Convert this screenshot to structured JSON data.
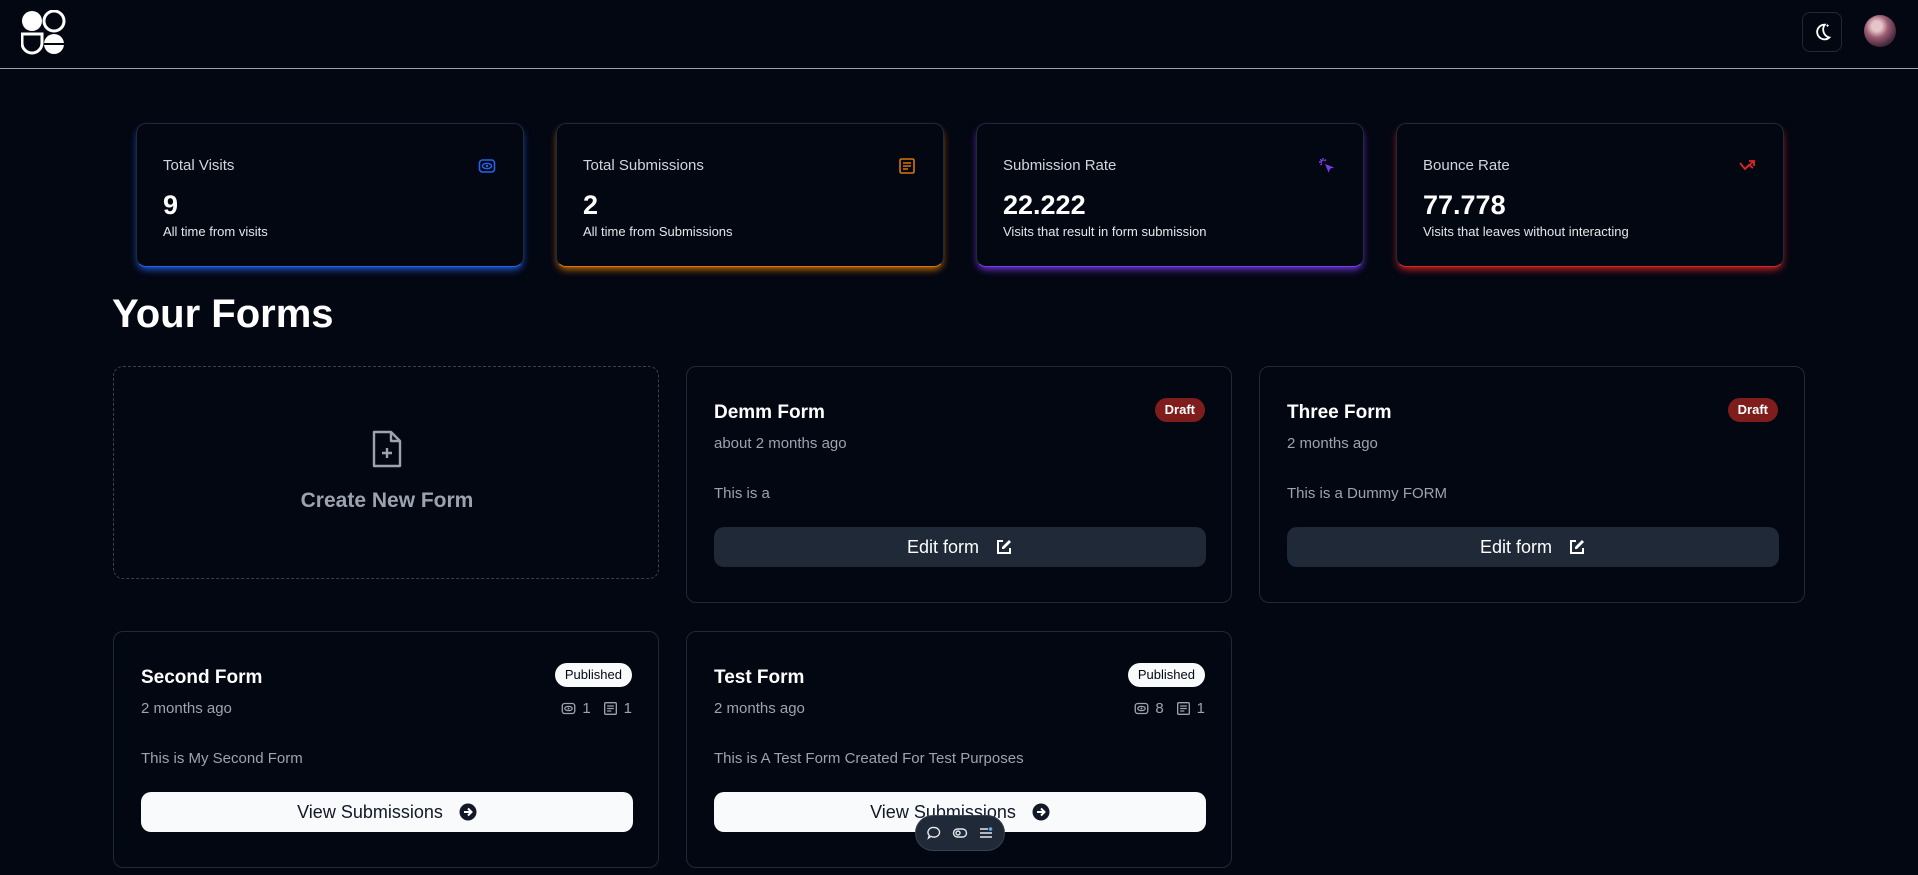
{
  "header": {
    "logo": "app-logo",
    "theme_icon": "moon-icon",
    "avatar": "user-avatar"
  },
  "stats": [
    {
      "title": "Total Visits",
      "value": "9",
      "help": "All time from visits",
      "icon": "eye-icon",
      "color": "#2563eb"
    },
    {
      "title": "Total Submissions",
      "value": "2",
      "help": "All time from Submissions",
      "icon": "submissions-icon",
      "color": "#d97706"
    },
    {
      "title": "Submission Rate",
      "value": "22.222",
      "help": "Visits that result in form submission",
      "icon": "cursor-click-icon",
      "color": "#7c3aed"
    },
    {
      "title": "Bounce Rate",
      "value": "77.778",
      "help": "Visits that leaves without interacting",
      "icon": "bounce-arrow-icon",
      "color": "#dc2626"
    }
  ],
  "section_title": "Your Forms",
  "create_label": "Create New Form",
  "forms": [
    {
      "name": "Demm Form",
      "time": "about 2 months ago",
      "desc": "This is a",
      "badge": "Draft",
      "button": "Edit form"
    },
    {
      "name": "Three Form",
      "time": "2 months ago",
      "desc": "This is a Dummy FORM",
      "badge": "Draft",
      "button": "Edit form"
    },
    {
      "name": "Second Form",
      "time": "2 months ago",
      "desc": "This is My Second Form",
      "badge": "Published",
      "button": "View Submissions",
      "visits": "1",
      "submissions": "1"
    },
    {
      "name": "Test Form",
      "time": "2 months ago",
      "desc": "This is A Test Form Created For Test Purposes",
      "badge": "Published",
      "button": "View Submissions",
      "visits": "8",
      "submissions": "1"
    }
  ]
}
